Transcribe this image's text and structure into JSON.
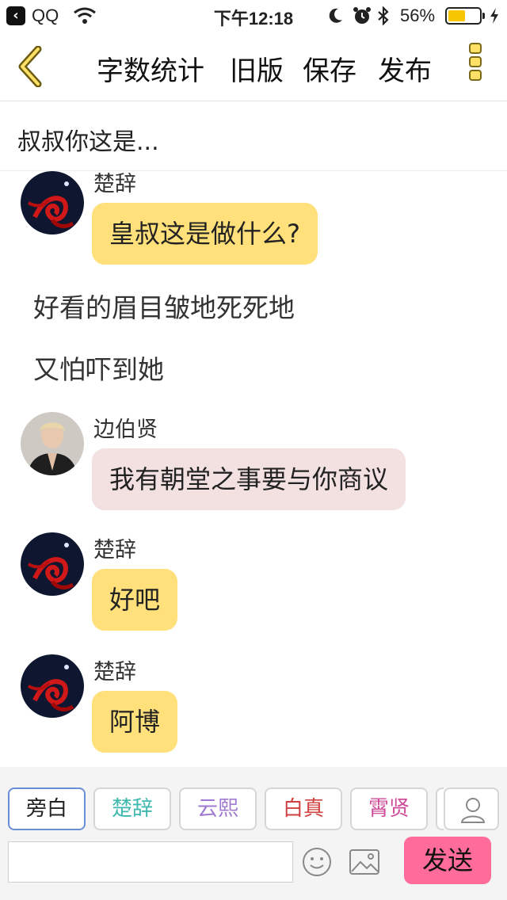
{
  "status_bar": {
    "back_app": "QQ",
    "time": "下午12:18",
    "battery_pct_text": "56%",
    "battery_level": 0.56,
    "battery_color": "#f7c600"
  },
  "nav": {
    "back_icon": "chevron-left-icon",
    "word_count": "字数统计",
    "old_version": "旧版",
    "save": "保存",
    "publish": "发布",
    "more_icon": "more-vertical-icon"
  },
  "title": "叔叔你这是...",
  "chat": {
    "messages": [
      {
        "kind": "bubble",
        "sender": "楚辞",
        "text": "皇叔这是做什么?",
        "bubble_color": "#ffe07a"
      },
      {
        "kind": "narration",
        "text": "好看的眉目皱地死死地"
      },
      {
        "kind": "narration",
        "text": "又怕吓到她"
      },
      {
        "kind": "bubble",
        "sender": "边伯贤",
        "text": "我有朝堂之事要与你商议",
        "bubble_color": "#f3e0e0"
      },
      {
        "kind": "bubble",
        "sender": "楚辞",
        "text": "好吧",
        "bubble_color": "#ffe07a"
      },
      {
        "kind": "bubble",
        "sender": "楚辞",
        "text": "阿博",
        "bubble_color": "#ffe07a"
      }
    ]
  },
  "characters": [
    {
      "label": "旁白",
      "color": "#222222",
      "active": true
    },
    {
      "label": "楚辞",
      "color": "#3fb8b0",
      "active": false
    },
    {
      "label": "云熙",
      "color": "#a07ad0",
      "active": false
    },
    {
      "label": "白真",
      "color": "#d04040",
      "active": false
    },
    {
      "label": "霄贤",
      "color": "#d04a9a",
      "active": false
    }
  ],
  "composer": {
    "input_value": "",
    "send_label": "发送",
    "send_color": "#ff6c99"
  }
}
